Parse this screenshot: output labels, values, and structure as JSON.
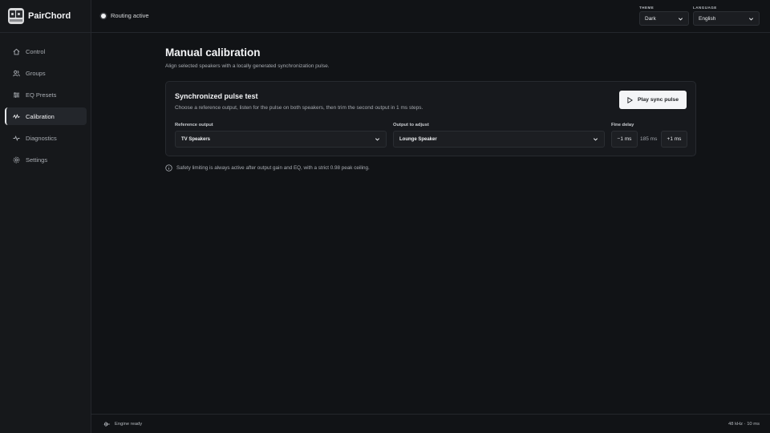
{
  "app": {
    "name": "PairChord"
  },
  "sidebar": {
    "items": [
      {
        "label": "Control",
        "icon": "home-icon",
        "active": false
      },
      {
        "label": "Groups",
        "icon": "users-icon",
        "active": false
      },
      {
        "label": "EQ Presets",
        "icon": "sliders-icon",
        "active": false
      },
      {
        "label": "Calibration",
        "icon": "pulse-icon",
        "active": true
      },
      {
        "label": "Diagnostics",
        "icon": "activity-icon",
        "active": false
      },
      {
        "label": "Settings",
        "icon": "gear-icon",
        "active": false
      }
    ]
  },
  "topbar": {
    "status": "Routing active",
    "theme": {
      "label": "THEME",
      "value": "Dark"
    },
    "language": {
      "label": "LANGUAGE",
      "value": "English"
    }
  },
  "main": {
    "title": "Manual calibration",
    "subtitle": "Align selected speakers with a locally generated synchronization pulse.",
    "card": {
      "title": "Synchronized pulse test",
      "description": "Choose a reference output, listen for the pulse on both speakers, then trim the second output in 1 ms steps.",
      "play_label": "Play sync pulse",
      "reference": {
        "label": "Reference output",
        "value": "TV Speakers"
      },
      "adjust": {
        "label": "Output to adjust",
        "value": "Lounge Speaker"
      },
      "delay": {
        "label": "Fine delay",
        "minus": "−1 ms",
        "value": "185 ms",
        "plus": "+1 ms"
      }
    },
    "note": "Safety limiting is always active after output gain and EQ, with a strict 0.98 peak ceiling."
  },
  "footer": {
    "engine": "Engine ready",
    "info": "48 kHz · 10 ms"
  },
  "colors": {
    "background": "#111316",
    "sidebar": "#16181b",
    "card": "#17191d",
    "accent": "#f4f5f7"
  }
}
